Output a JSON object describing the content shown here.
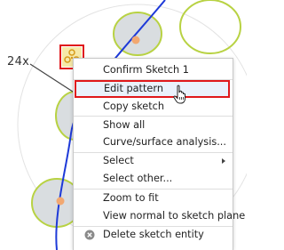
{
  "callout": {
    "label": "24x"
  },
  "menu": {
    "items": [
      {
        "label": "Confirm Sketch 1"
      },
      {
        "label": "Edit pattern"
      },
      {
        "label": "Copy sketch"
      },
      {
        "label": "Show all"
      },
      {
        "label": "Curve/surface analysis..."
      },
      {
        "label": "Select"
      },
      {
        "label": "Select other..."
      },
      {
        "label": "Zoom to fit"
      },
      {
        "label": "View normal to sketch plane"
      },
      {
        "label": "Delete sketch entity"
      }
    ]
  },
  "colors": {
    "highlight_border": "#e0181b",
    "curve": "#1e3ad8",
    "ellipse_stroke": "#b8d243",
    "ellipse_fill": "#d9dde0",
    "point": "#f2a871"
  },
  "icons": {
    "pattern": "circular-pattern-icon",
    "submenu": "chevron-right-icon",
    "delete": "delete-circle-x-icon",
    "cursor": "hand-pointer-icon"
  }
}
